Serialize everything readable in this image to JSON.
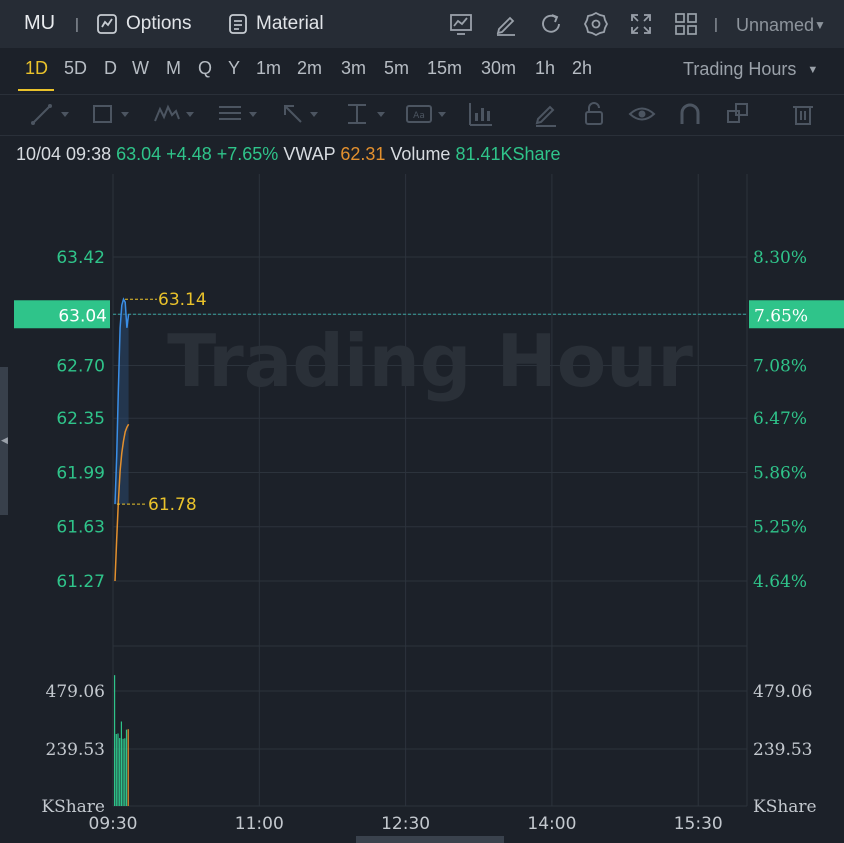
{
  "header": {
    "ticker": "MU",
    "options_label": "Options",
    "material_label": "Material",
    "layout_name": "Unnamed",
    "icons": [
      "chart-icon",
      "edit-icon",
      "refresh-icon",
      "settings-icon",
      "fullscreen-icon",
      "grid-icon"
    ]
  },
  "periods": {
    "items": [
      "1D",
      "5D",
      "D",
      "W",
      "M",
      "Q",
      "Y",
      "1m",
      "2m",
      "3m",
      "5m",
      "15m",
      "30m",
      "1h",
      "2h"
    ],
    "active": "1D",
    "session_label": "Trading Hours"
  },
  "toolbar": {
    "tools": [
      "line-tool-icon",
      "rectangle-tool-icon",
      "wave-tool-icon",
      "fib-tool-icon",
      "arrow-tool-icon",
      "measure-tool-icon",
      "text-tool-icon",
      "pattern-tool-icon",
      "pen-tool-icon",
      "lock-icon",
      "eye-icon",
      "magnet-icon",
      "copy-icon",
      "trash-icon"
    ]
  },
  "info": {
    "datetime": "10/04 09:38",
    "price": "63.04",
    "change": "+4.48",
    "change_pct": "+7.65%",
    "vwap_label": "VWAP",
    "vwap_value": "62.31",
    "volume_label": "Volume",
    "volume_value": "81.41KShare"
  },
  "chart_data": {
    "type": "line",
    "watermark": "Trading Hour",
    "price_axis_left": [
      "63.42",
      "63.04",
      "62.70",
      "62.35",
      "61.99",
      "61.63",
      "61.27"
    ],
    "price_axis_right": [
      "8.30%",
      "7.65%",
      "7.08%",
      "6.47%",
      "5.86%",
      "5.25%",
      "4.64%"
    ],
    "current_price": "63.04",
    "current_pct": "7.65%",
    "high_label": "63.14",
    "low_label": "61.78",
    "volume_axis_left": [
      "479.06",
      "239.53",
      "KShare"
    ],
    "volume_axis_right": [
      "479.06",
      "239.53",
      "KShare"
    ],
    "time_axis": [
      "09:30",
      "11:00",
      "12:30",
      "14:00",
      "15:30"
    ],
    "series": [
      {
        "name": "price",
        "color": "#3a8ee6",
        "x": [
          "09:30",
          "09:31",
          "09:32",
          "09:33",
          "09:34",
          "09:35",
          "09:36",
          "09:37",
          "09:38"
        ],
        "values": [
          61.78,
          62.1,
          62.55,
          62.95,
          63.1,
          63.14,
          63.12,
          62.95,
          63.04
        ]
      },
      {
        "name": "VWAP",
        "color": "#e3902e",
        "x": [
          "09:30",
          "09:31",
          "09:32",
          "09:33",
          "09:34",
          "09:35",
          "09:36",
          "09:37",
          "09:38"
        ],
        "values": [
          61.27,
          61.55,
          61.8,
          62.0,
          62.12,
          62.2,
          62.26,
          62.29,
          62.31
        ]
      }
    ],
    "volume_values": [
      545,
      300,
      302,
      283,
      352,
      280,
      282,
      318,
      320
    ],
    "colors": {
      "up": "#2fc48a",
      "line": "#3a8ee6",
      "vwap": "#e3902e",
      "label": "#e9c22b",
      "grid": "#2c333c",
      "axis_text": "#2fc48a"
    }
  }
}
